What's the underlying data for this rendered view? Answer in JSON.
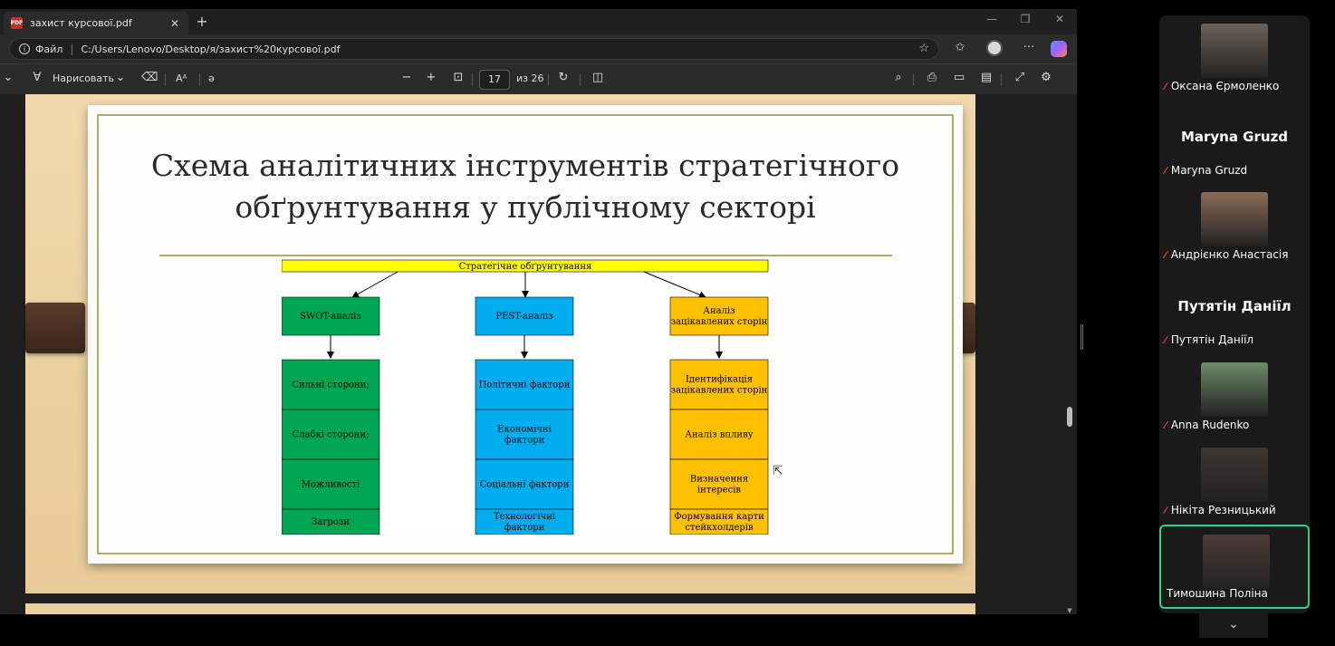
{
  "browser": {
    "tab_title": "захист курсової.pdf",
    "tab_icon_text": "PDF",
    "address": {
      "label": "Файл",
      "url": "C:/Users/Lenovo/Desktop/я/захист%20курсової.pdf"
    },
    "pdf_toolbar": {
      "draw_label": "Нарисовать",
      "read_aloud": "Aᴬ",
      "page_current": "17",
      "page_total": "из 26"
    }
  },
  "slide": {
    "title": "Схема аналітичних інструментів стратегічного обґрунтування у публічному секторі"
  },
  "diagram": {
    "root": "Стратегічне обґрунтування",
    "colors": {
      "root": "#ffff00",
      "green": "#00a651",
      "blue": "#00aeef",
      "orange": "#ffc000"
    },
    "columns": [
      {
        "header": [
          "SWOT-аналіз"
        ],
        "items": [
          [
            "Сильні сторони;"
          ],
          [
            "Слабкі сторони;"
          ],
          [
            "Можливості"
          ],
          [
            "Загрози"
          ]
        ]
      },
      {
        "header": [
          "PEST-аналіз"
        ],
        "items": [
          [
            "Політичні фактори"
          ],
          [
            "Економічні",
            "фактори"
          ],
          [
            "Соціальні фактори"
          ],
          [
            "Технологічні",
            "фактори"
          ]
        ]
      },
      {
        "header": [
          "Аналіз",
          "зацікавлених сторін"
        ],
        "items": [
          [
            "Ідентифікація",
            "зацікавлених сторін"
          ],
          [
            "Аналіз впливу"
          ],
          [
            "Визначення",
            "інтересів"
          ],
          [
            "Формування карти",
            "стейкхолдерів"
          ]
        ]
      }
    ]
  },
  "participants": [
    {
      "name": "Оксана Єрмоленко",
      "photo": "#6c6258",
      "muted": true
    },
    {
      "name": "Maryna Gruzd",
      "big_name": "Maryna Gruzd",
      "muted": true
    },
    {
      "name": "Андрієнко Анастасія",
      "photo": "#8a6b58",
      "muted": true
    },
    {
      "name": "Путятін Даніїл",
      "big_name": "Путятін Даніїл",
      "muted": true
    },
    {
      "name": "Anna Rudenko",
      "photo": "#6f8a6a",
      "muted": true
    },
    {
      "name": "Нікіта Резницький",
      "photo": "#3d3733",
      "muted": true
    },
    {
      "name": "Тимошина Поліна",
      "photo": "#4d3b38",
      "muted": false,
      "active": true
    }
  ]
}
